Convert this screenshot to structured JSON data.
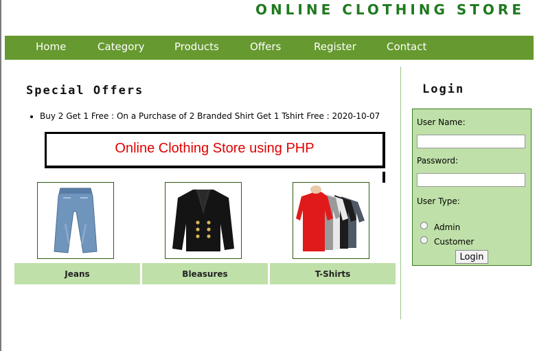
{
  "header": {
    "site_title": "ONLINE CLOTHING STORE"
  },
  "nav": {
    "items": [
      {
        "label": "Home"
      },
      {
        "label": "Category"
      },
      {
        "label": "Products"
      },
      {
        "label": "Offers"
      },
      {
        "label": "Register"
      },
      {
        "label": "Contact"
      }
    ]
  },
  "offers": {
    "title": "Special Offers",
    "items": [
      "Buy 2 Get 1 Free : On a Purchase of 2 Branded Shirt Get 1 Tshirt Free : 2020-10-07"
    ],
    "banner_text": "Online Clothing Store using PHP"
  },
  "products": [
    {
      "name": "Jeans",
      "icon": "jeans-image"
    },
    {
      "name": "Bleasures",
      "icon": "blazer-image"
    },
    {
      "name": "T-Shirts",
      "icon": "tshirts-image"
    }
  ],
  "login": {
    "title": "Login",
    "username_label": "User Name:",
    "username_value": "",
    "password_label": "Password:",
    "password_value": "",
    "user_type_label": "User Type:",
    "options": [
      {
        "label": "Admin",
        "selected": false
      },
      {
        "label": "Customer",
        "selected": false
      }
    ],
    "button_label": "Login"
  },
  "colors": {
    "nav_bg": "#66992f",
    "title_green": "#1f7a1f",
    "panel_bg": "#bfe0a8",
    "banner_text": "#e00000"
  }
}
